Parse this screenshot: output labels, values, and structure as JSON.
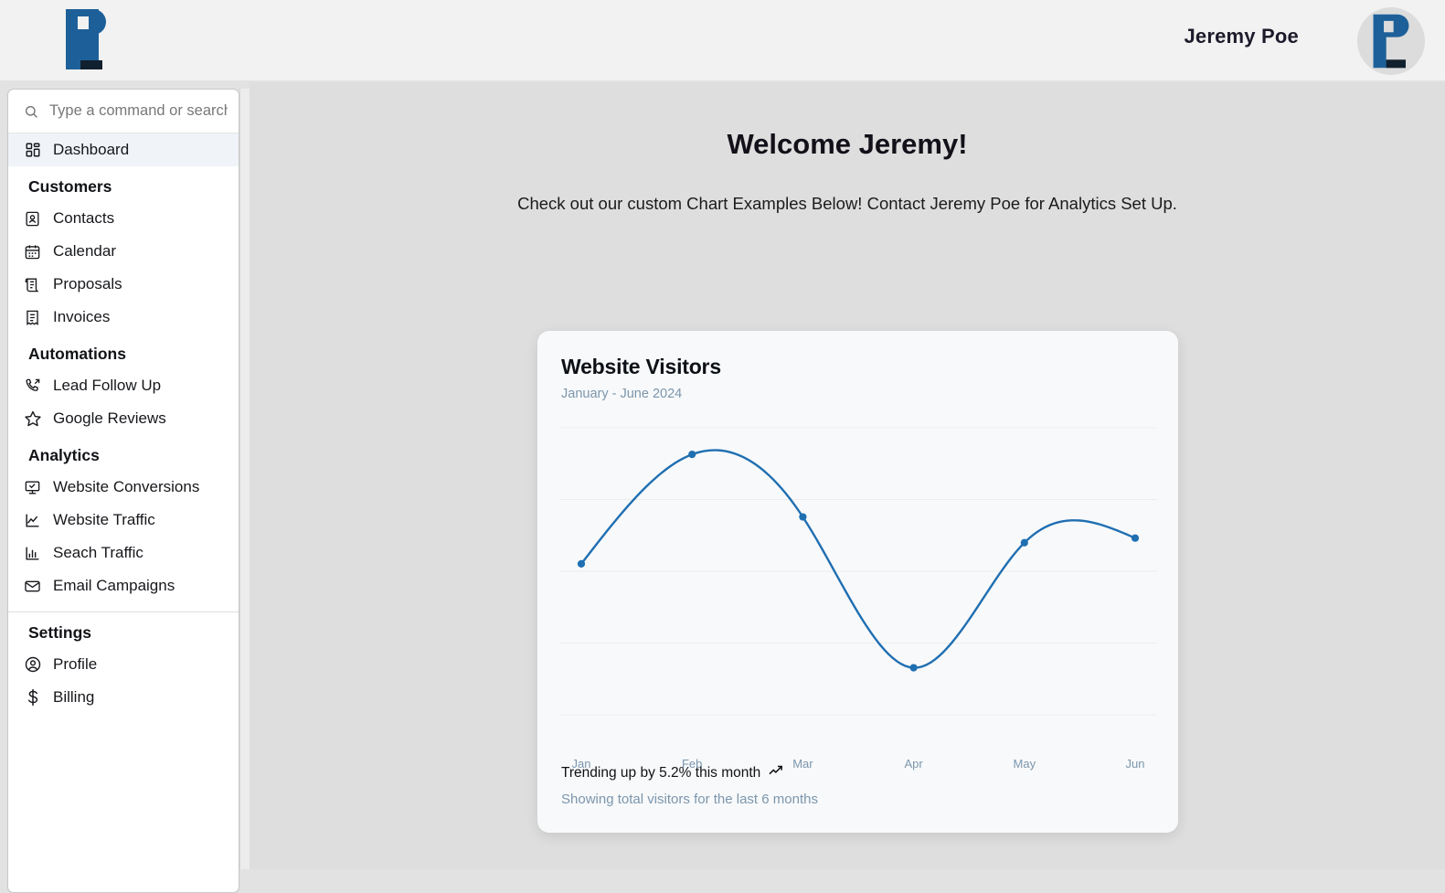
{
  "header": {
    "user_name": "Jeremy Poe",
    "logo_icon": "pl-monogram-logo",
    "avatar_icon": "pl-monogram-avatar"
  },
  "sidebar": {
    "search": {
      "placeholder": "Type a command or search..",
      "value": "",
      "icon": "search-icon"
    },
    "primary": [
      {
        "label": "Dashboard",
        "icon": "layout-grid-icon",
        "active": true
      }
    ],
    "groups": [
      {
        "title": "Customers",
        "items": [
          {
            "label": "Contacts",
            "icon": "contact-card-icon"
          },
          {
            "label": "Calendar",
            "icon": "calendar-icon"
          },
          {
            "label": "Proposals",
            "icon": "scroll-text-icon"
          },
          {
            "label": "Invoices",
            "icon": "receipt-icon"
          }
        ]
      },
      {
        "title": "Automations",
        "items": [
          {
            "label": "Lead Follow Up",
            "icon": "phone-outgoing-icon"
          },
          {
            "label": "Google Reviews",
            "icon": "star-icon"
          }
        ]
      },
      {
        "title": "Analytics",
        "items": [
          {
            "label": "Website Conversions",
            "icon": "monitor-check-icon"
          },
          {
            "label": "Website Traffic",
            "icon": "line-chart-icon"
          },
          {
            "label": "Seach Traffic",
            "icon": "bar-chart-icon"
          },
          {
            "label": "Email Campaigns",
            "icon": "mail-icon"
          }
        ]
      },
      {
        "title": "Settings",
        "divider_above": true,
        "items": [
          {
            "label": "Profile",
            "icon": "user-circle-icon"
          },
          {
            "label": "Billing",
            "icon": "dollar-sign-icon"
          }
        ]
      }
    ]
  },
  "main": {
    "welcome_title": "Welcome Jeremy!",
    "welcome_subtitle": "Check out our custom Chart Examples Below! Contact Jeremy Poe for Analytics Set Up."
  },
  "card": {
    "title": "Website Visitors",
    "subtitle": "January - June 2024",
    "trend_text": "Trending up by 5.2% this month",
    "trend_icon": "trending-up-icon",
    "footer_note": "Showing total visitors for the last 6 months"
  },
  "colors": {
    "line": "#1f6fb2",
    "point": "#1f6fb2",
    "muted_text": "#7b96ad",
    "active_nav_bg": "#f0f3f7",
    "logo_blue": "#1d6099",
    "logo_navy": "#11202e"
  },
  "chart_data": {
    "type": "line",
    "title": "Website Visitors",
    "subtitle": "January - June 2024",
    "categories": [
      "Jan",
      "Feb",
      "Mar",
      "Apr",
      "May",
      "Jun"
    ],
    "values": [
      186,
      305,
      237,
      73,
      209,
      214
    ],
    "series": [
      {
        "name": "Visitors",
        "values": [
          186,
          305,
          237,
          73,
          209,
          214
        ]
      }
    ],
    "xlabel": "",
    "ylabel": "",
    "ylim": [
      0,
      330
    ],
    "grid": true,
    "grid_axis": "y",
    "legend": false,
    "curve": "natural",
    "show_points": true,
    "line_color": "#1f6fb2",
    "annotations": [
      "Trending up by 5.2% this month",
      "Showing total visitors for the last 6 months"
    ]
  }
}
